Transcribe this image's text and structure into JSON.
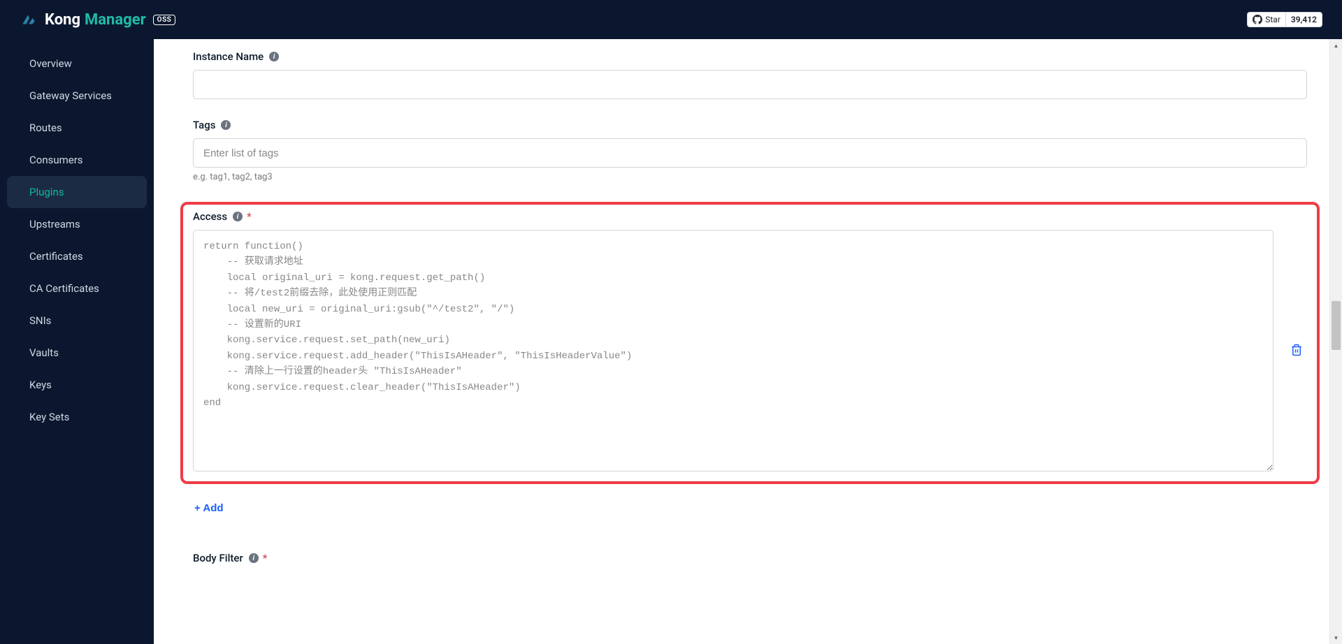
{
  "header": {
    "brand_kong": "Kong",
    "brand_manager": "Manager",
    "oss_badge": "OSS",
    "github_star_label": "Star",
    "github_star_count": "39,412"
  },
  "sidebar": {
    "items": [
      {
        "label": "Overview",
        "active": false
      },
      {
        "label": "Gateway Services",
        "active": false
      },
      {
        "label": "Routes",
        "active": false
      },
      {
        "label": "Consumers",
        "active": false
      },
      {
        "label": "Plugins",
        "active": true
      },
      {
        "label": "Upstreams",
        "active": false
      },
      {
        "label": "Certificates",
        "active": false
      },
      {
        "label": "CA Certificates",
        "active": false
      },
      {
        "label": "SNIs",
        "active": false
      },
      {
        "label": "Vaults",
        "active": false
      },
      {
        "label": "Keys",
        "active": false
      },
      {
        "label": "Key Sets",
        "active": false
      }
    ]
  },
  "form": {
    "instance_name": {
      "label": "Instance Name",
      "value": ""
    },
    "tags": {
      "label": "Tags",
      "placeholder": "Enter list of tags",
      "value": "",
      "hint": "e.g. tag1, tag2, tag3"
    },
    "access": {
      "label": "Access",
      "required": "*",
      "code": "return function()\n    -- 获取请求地址\n    local original_uri = kong.request.get_path()\n    -- 将/test2前缀去除，此处使用正则匹配\n    local new_uri = original_uri:gsub(\"^/test2\", \"/\")\n    -- 设置新的URI\n    kong.service.request.set_path(new_uri)\n    kong.service.request.add_header(\"ThisIsAHeader\", \"ThisIsHeaderValue\")\n    -- 清除上一行设置的header头 \"ThisIsAHeader\"\n    kong.service.request.clear_header(\"ThisIsAHeader\")\nend",
      "add_button": "+ Add"
    },
    "body_filter": {
      "label": "Body Filter",
      "required": "*"
    }
  }
}
